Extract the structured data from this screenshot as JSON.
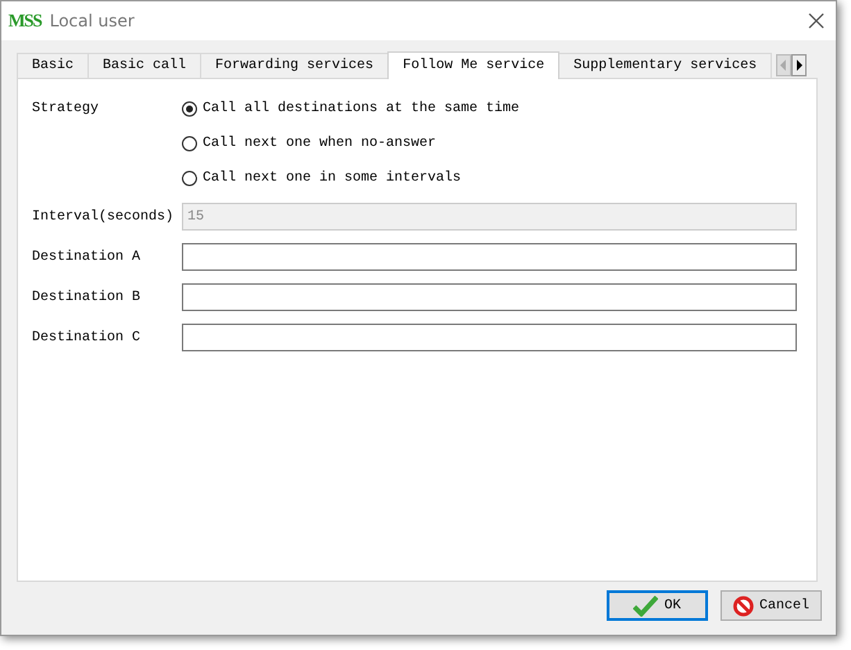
{
  "window": {
    "logo": "MSS",
    "title": "Local user"
  },
  "tabs": [
    {
      "label": "Basic",
      "selected": false
    },
    {
      "label": "Basic call",
      "selected": false
    },
    {
      "label": "Forwarding services",
      "selected": false
    },
    {
      "label": "Follow Me service",
      "selected": true
    },
    {
      "label": "Supplementary services",
      "selected": false
    }
  ],
  "strategy": {
    "label": "Strategy",
    "options": [
      {
        "label": "Call all destinations at the same time",
        "selected": true
      },
      {
        "label": "Call next one when no-answer",
        "selected": false
      },
      {
        "label": "Call next one in some intervals",
        "selected": false
      }
    ]
  },
  "fields": [
    {
      "label": "Interval(seconds)",
      "value": "15",
      "disabled": true
    },
    {
      "label": "Destination A",
      "disabled": false
    },
    {
      "label": "Destination B",
      "disabled": false
    },
    {
      "label": "Destination C",
      "disabled": false
    }
  ],
  "buttons": [
    {
      "label": "OK",
      "kind": "ok"
    },
    {
      "label": "Cancel",
      "kind": "cancel"
    }
  ]
}
